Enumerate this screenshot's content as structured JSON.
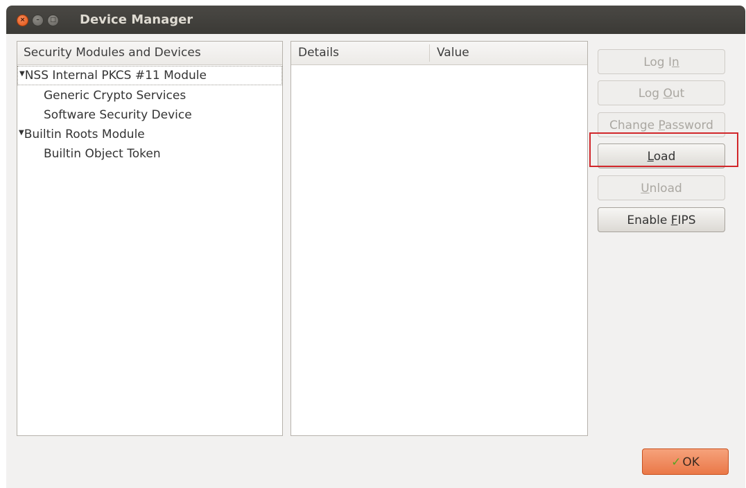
{
  "window": {
    "title": "Device Manager",
    "controls": {
      "close": "×",
      "minimize": "–",
      "maximize": "□"
    }
  },
  "tree": {
    "header": "Security Modules and Devices",
    "items": [
      {
        "label": "NSS Internal PKCS #11 Module",
        "level": 0,
        "expanded": true,
        "selected": true
      },
      {
        "label": "Generic Crypto Services",
        "level": 1
      },
      {
        "label": "Software Security Device",
        "level": 1
      },
      {
        "label": "Builtin Roots Module",
        "level": 0,
        "expanded": true
      },
      {
        "label": "Builtin Object Token",
        "level": 1
      }
    ],
    "expand_glyph": "▼"
  },
  "details": {
    "col_details": "Details",
    "col_value": "Value"
  },
  "buttons": {
    "login": {
      "before": "Log I",
      "mnemonic": "n",
      "after": "",
      "enabled": false
    },
    "logout": {
      "before": "Log ",
      "mnemonic": "O",
      "after": "ut",
      "enabled": false
    },
    "change_password": {
      "before": "Change ",
      "mnemonic": "P",
      "after": "assword",
      "enabled": false
    },
    "load": {
      "before": "",
      "mnemonic": "L",
      "after": "oad",
      "enabled": true,
      "highlighted": true
    },
    "unload": {
      "before": "",
      "mnemonic": "U",
      "after": "nload",
      "enabled": false
    },
    "enable_fips": {
      "before": "Enable ",
      "mnemonic": "F",
      "after": "IPS",
      "enabled": true
    },
    "ok": {
      "label": "OK",
      "icon": "check-icon"
    }
  },
  "colors": {
    "highlight": "#d1262a",
    "ok_button": "#ea7848",
    "titlebar": "#3b3a36"
  }
}
